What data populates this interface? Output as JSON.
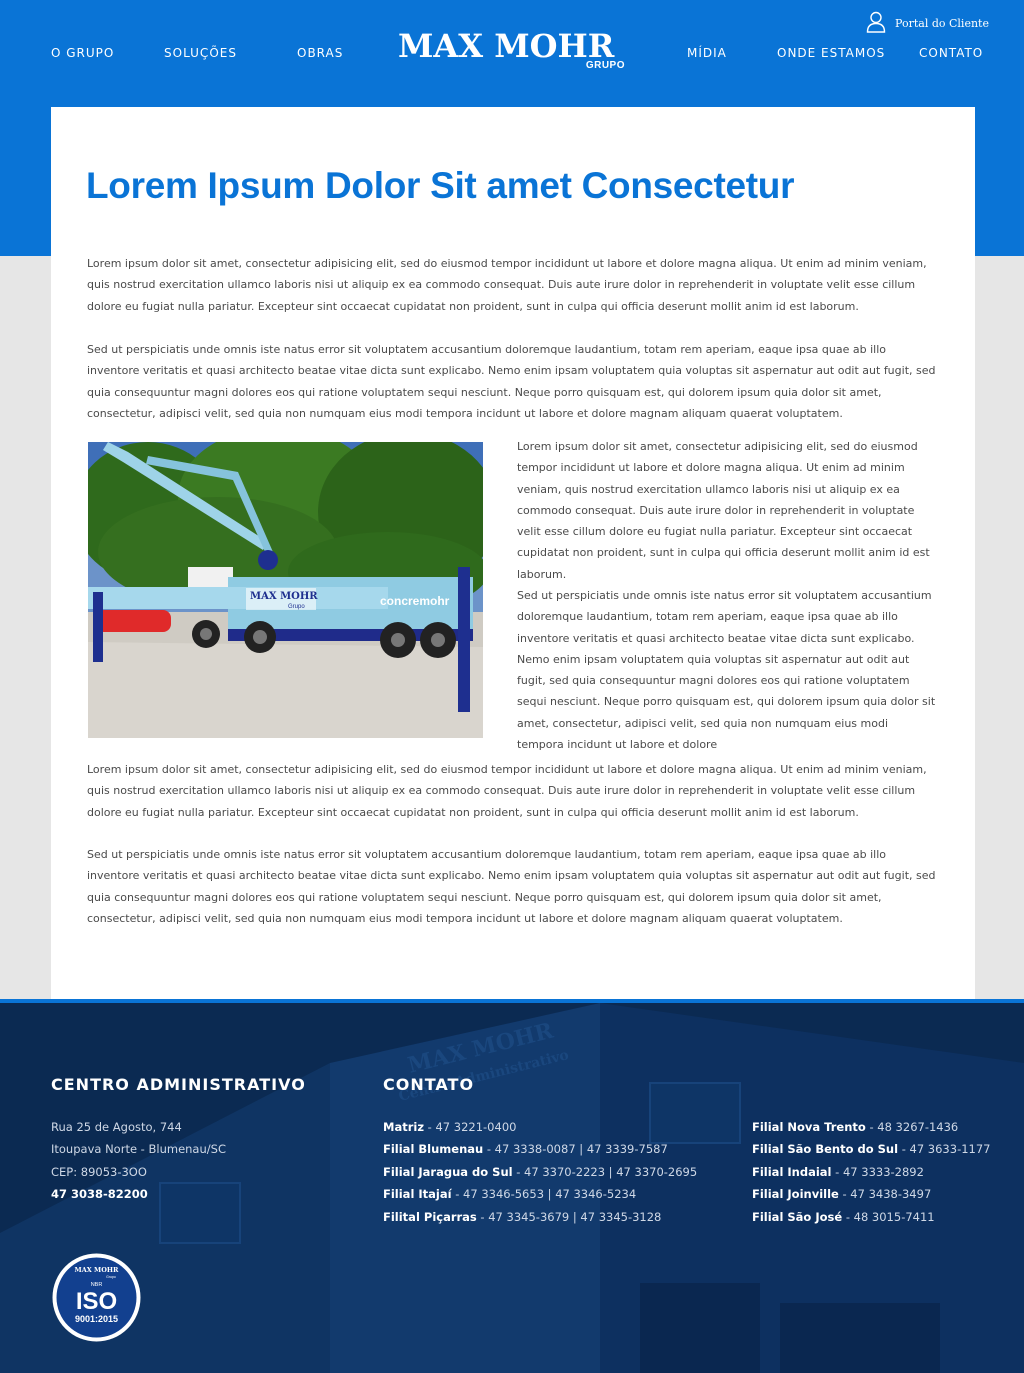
{
  "header": {
    "nav_left": [
      "O GRUPO",
      "SOLUÇÕES",
      "OBRAS"
    ],
    "nav_right": [
      "MÍDIA",
      "ONDE ESTAMOS",
      "CONTATO"
    ],
    "logo_text": "MAX MOHR",
    "logo_sub": "GRUPO",
    "portal_label": "Portal do Cliente"
  },
  "article": {
    "title": "Lorem Ipsum Dolor Sit amet Consectetur",
    "p1": "Lorem ipsum dolor sit amet, consectetur adipisicing elit, sed do eiusmod tempor incididunt ut labore et dolore magna aliqua. Ut enim ad minim veniam, quis nostrud exercitation ullamco laboris nisi ut aliquip ex ea commodo consequat. Duis aute irure dolor in reprehenderit in voluptate velit esse cillum dolore eu fugiat nulla pariatur. Excepteur sint occaecat cupidatat non proident, sunt in culpa qui officia deserunt mollit anim id est laborum.",
    "p2": " Sed ut perspiciatis unde omnis iste natus error sit voluptatem accusantium doloremque laudantium, totam rem aperiam, eaque ipsa quae ab illo inventore veritatis et quasi architecto beatae vitae dicta sunt explicabo. Nemo enim ipsam voluptatem quia voluptas sit aspernatur aut odit aut fugit, sed quia consequuntur magni dolores eos qui ratione voluptatem sequi nesciunt. Neque porro quisquam est, qui dolorem ipsum quia dolor sit amet, consectetur, adipisci velit, sed quia non numquam eius modi tempora incidunt ut labore et dolore magnam aliquam quaerat voluptatem.",
    "col1": "Lorem ipsum dolor sit amet, consectetur adipisicing elit, sed do eiusmod tempor incididunt ut labore et dolore magna aliqua. Ut enim ad minim veniam, quis nostrud exercitation ullamco laboris nisi ut aliquip ex ea commodo consequat. Duis aute irure dolor in reprehenderit in voluptate velit esse cillum dolore eu fugiat nulla pariatur. Excepteur sint occaecat cupidatat non proident, sunt in culpa qui officia deserunt mollit anim id est laborum.",
    "col2": " Sed ut perspiciatis unde omnis iste natus error sit voluptatem accusantium doloremque laudantium, totam rem aperiam, eaque ipsa quae ab illo inventore veritatis et quasi architecto beatae vitae dicta sunt explicabo. Nemo enim ipsam voluptatem quia voluptas sit aspernatur aut odit aut fugit, sed quia consequuntur magni dolores eos qui ratione voluptatem sequi nesciunt. Neque porro quisquam est, qui dolorem ipsum quia dolor sit amet, consectetur, adipisci velit, sed quia non numquam eius modi tempora incidunt ut labore et dolore",
    "p3": "Lorem ipsum dolor sit amet, consectetur adipisicing elit, sed do eiusmod tempor incididunt ut labore et dolore magna aliqua. Ut enim ad minim veniam, quis nostrud exercitation ullamco laboris nisi ut aliquip ex ea commodo consequat. Duis aute irure dolor in reprehenderit in voluptate velit esse cillum dolore eu fugiat nulla pariatur. Excepteur sint occaecat cupidatat non proident, sunt in culpa qui officia deserunt mollit anim id est laborum.",
    "p4": " Sed ut perspiciatis unde omnis iste natus error sit voluptatem accusantium doloremque laudantium, totam rem aperiam, eaque ipsa quae ab illo inventore veritatis et quasi architecto beatae vitae dicta sunt explicabo. Nemo enim ipsam voluptatem quia voluptas sit aspernatur aut odit aut fugit, sed quia consequuntur magni dolores eos qui ratione voluptatem sequi nesciunt. Neque porro quisquam est, qui dolorem ipsum quia dolor sit amet, consectetur, adipisci velit, sed quia non numquam eius modi tempora incidunt ut labore et dolore magnam aliquam quaerat voluptatem.",
    "photo_truck_text_1": "MAX MOHR",
    "photo_truck_text_2": "Grupo",
    "photo_truck_text_3": "concremohr"
  },
  "footer": {
    "admin_heading": "CENTRO ADMINISTRATIVO",
    "address_1": "Rua 25 de Agosto, 744",
    "address_2": "Itoupava Norte - Blumenau/SC",
    "cep": "CEP: 89053-3OO",
    "phone": "47 3038-82200",
    "contact_heading": "CONTATO",
    "contacts_left": [
      {
        "name": "Matriz",
        "phone": " - 47 3221-0400"
      },
      {
        "name": "Filial Blumenau",
        "phone": " - 47 3338-0087 | 47 3339-7587"
      },
      {
        "name": "Filial Jaragua do Sul",
        "phone": " - 47 3370-2223 | 47 3370-2695"
      },
      {
        "name": "Filial Itajaí",
        "phone": " -  47 3346-5653 | 47 3346-5234"
      },
      {
        "name": "Filital Piçarras",
        "phone": " - 47 3345-3679 | 47 3345-3128"
      }
    ],
    "contacts_right": [
      {
        "name": "Filial Nova Trento",
        "phone": " - 48 3267-1436"
      },
      {
        "name": "Filial São Bento do Sul",
        "phone": " - 47 3633-1177"
      },
      {
        "name": "Filial Indaial",
        "phone": " - 47 3333-2892"
      },
      {
        "name": "Filial Joinville",
        "phone": " - 47 3438-3497"
      },
      {
        "name": "Filial São José",
        "phone": " - 48 3015-7411"
      }
    ],
    "bg_building_text_1": "MAX MOHR",
    "bg_building_text_2": "Centro Administrativo",
    "iso_brand": "MAX MOHR",
    "iso_brand_sub": "Grupo",
    "iso_nbr": "NBR",
    "iso_text": "ISO",
    "iso_number": "9001:2015"
  },
  "colors": {
    "primary": "#0a74d6",
    "footer_bg": "#0b2a52",
    "page_bg": "#e6e6e6"
  }
}
